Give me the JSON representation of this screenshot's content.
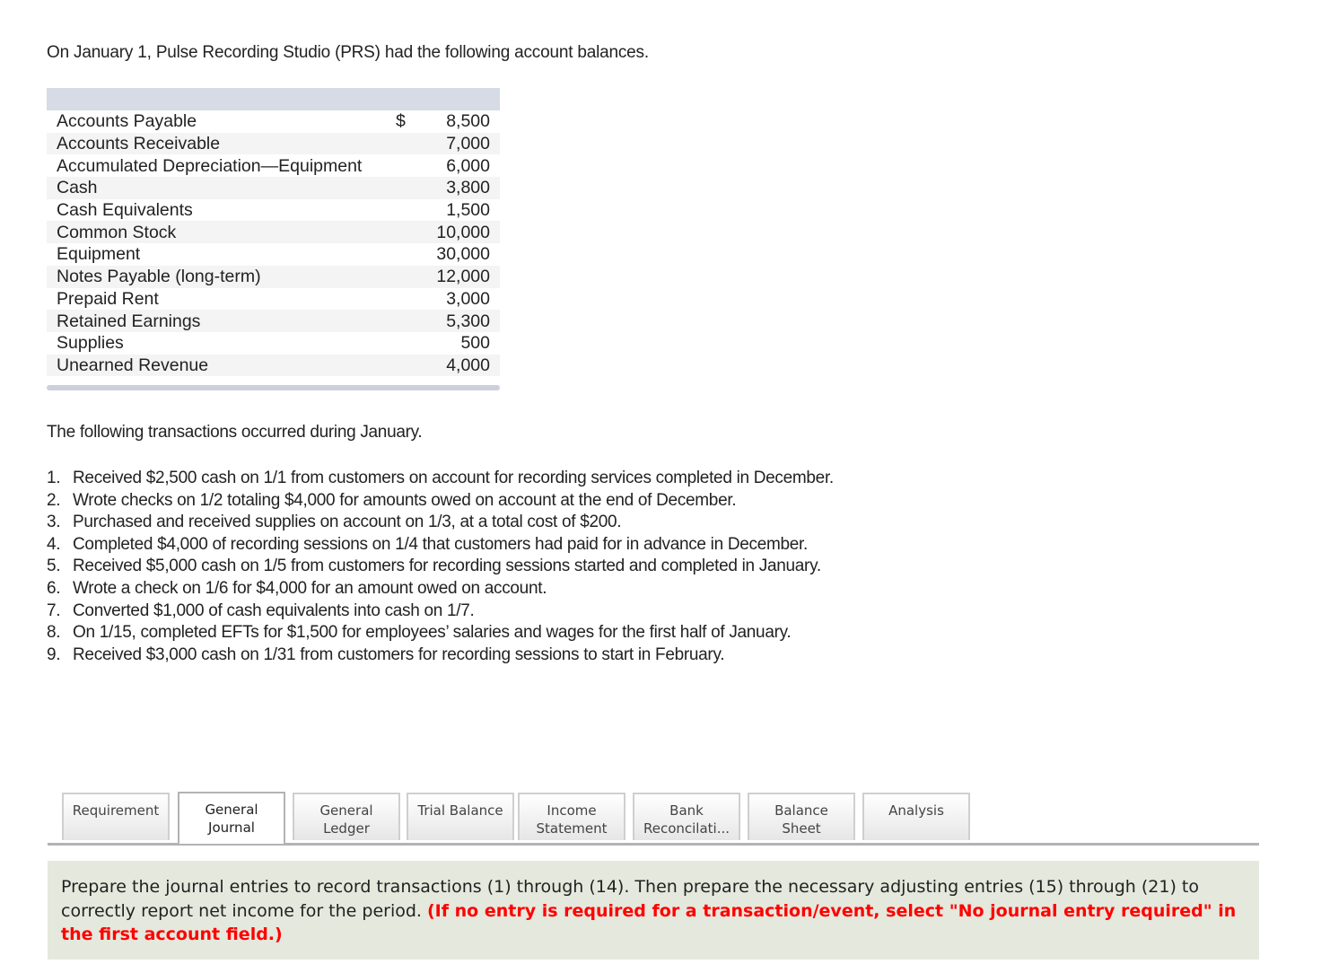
{
  "intro": "On January 1, Pulse Recording Studio (PRS) had the following account balances.",
  "balances": {
    "currency_symbol": "$",
    "rows": [
      {
        "account": "Accounts Payable",
        "amount": "8,500"
      },
      {
        "account": "Accounts Receivable",
        "amount": "7,000"
      },
      {
        "account": "Accumulated Depreciation—Equipment",
        "amount": "6,000"
      },
      {
        "account": "Cash",
        "amount": "3,800"
      },
      {
        "account": "Cash Equivalents",
        "amount": "1,500"
      },
      {
        "account": "Common Stock",
        "amount": "10,000"
      },
      {
        "account": "Equipment",
        "amount": "30,000"
      },
      {
        "account": "Notes Payable (long-term)",
        "amount": "12,000"
      },
      {
        "account": "Prepaid Rent",
        "amount": "3,000"
      },
      {
        "account": "Retained Earnings",
        "amount": "5,300"
      },
      {
        "account": "Supplies",
        "amount": "500"
      },
      {
        "account": "Unearned Revenue",
        "amount": "4,000"
      }
    ]
  },
  "transactions_intro": "The following transactions occurred during January.",
  "transactions": [
    {
      "num": "1.",
      "text": "Received $2,500 cash on 1/1 from customers on account for recording services completed in December."
    },
    {
      "num": "2.",
      "text": "Wrote checks on 1/2 totaling $4,000 for amounts owed on account at the end of December."
    },
    {
      "num": "3.",
      "text": "Purchased and received supplies on account on 1/3, at a total cost of $200."
    },
    {
      "num": "4.",
      "text": "Completed $4,000 of recording sessions on 1/4 that customers had paid for in advance in December."
    },
    {
      "num": "5.",
      "text": "Received $5,000 cash on 1/5 from customers for recording sessions started and completed in January."
    },
    {
      "num": "6.",
      "text": "Wrote a check on 1/6 for $4,000 for an amount owed on account."
    },
    {
      "num": "7.",
      "text": "Converted $1,000 of cash equivalents into cash on 1/7."
    },
    {
      "num": "8.",
      "text": "On 1/15, completed EFTs for $1,500 for employees’ salaries and wages for the first half of January."
    },
    {
      "num": "9.",
      "text": "Received $3,000 cash on 1/31 from customers for recording sessions to start in February."
    }
  ],
  "tabs": [
    {
      "line1": "Requirement",
      "line2": "",
      "active": false
    },
    {
      "line1": "General",
      "line2": "Journal",
      "active": true
    },
    {
      "line1": "General",
      "line2": "Ledger",
      "active": false
    },
    {
      "line1": "Trial Balance",
      "line2": "",
      "active": false
    },
    {
      "line1": "Income",
      "line2": "Statement",
      "active": false
    },
    {
      "line1": "Bank",
      "line2": "Reconcilati...",
      "active": false
    },
    {
      "line1": "Balance",
      "line2": "Sheet",
      "active": false
    },
    {
      "line1": "Analysis",
      "line2": "",
      "active": false
    }
  ],
  "instruction": {
    "text": "Prepare the journal entries to record transactions (1) through (14).  Then prepare the necessary adjusting entries (15) through (21) to correctly report net income for the period. ",
    "warning": "(If no entry is required for a transaction/event, select \"No journal entry required\" in the first account field.)"
  }
}
